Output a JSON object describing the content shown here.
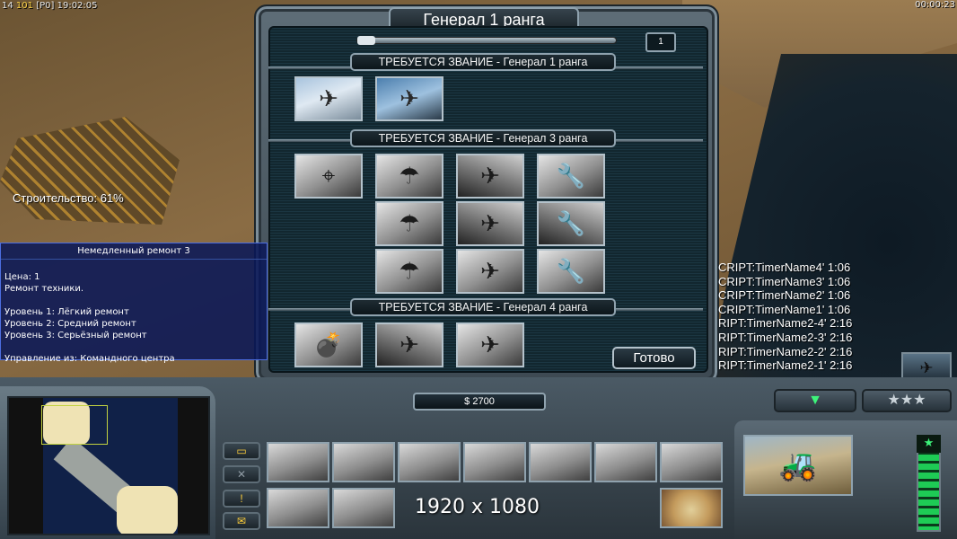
{
  "hud": {
    "top_left_prefix": "14",
    "top_left_gold": "101",
    "top_left_slot": "[P0]",
    "top_left_clock": "19:02:05",
    "top_right_clock": "00:00:23"
  },
  "world": {
    "construction_label": "Строительство: 61%"
  },
  "dialog": {
    "title": "Генерал 1 ранга",
    "points": "1",
    "done_label": "Готово",
    "sections": [
      {
        "header": "ТРЕБУЕТСЯ ЗВАНИЕ - Генерал 1 ранга"
      },
      {
        "header": "ТРЕБУЕТСЯ ЗВАНИЕ - Генерал 3 ранга"
      },
      {
        "header": "ТРЕБУЕТСЯ ЗВАНИЕ - Генерал 4 ранга"
      }
    ]
  },
  "tooltip": {
    "title": "Немедленный ремонт 3",
    "cost": "Цена: 1",
    "description": "Ремонт техники.",
    "level1": "Уровень 1: Лёгкий ремонт",
    "level2": "Уровень 2: Средний ремонт",
    "level3": "Уровень 3: Серьёзный ремонт",
    "control": "Управление из: Командного центра"
  },
  "timers": [
    "CRIPT:TimerName4' 1:06",
    "CRIPT:TimerName3' 1:06",
    "CRIPT:TimerName2' 1:06",
    "CRIPT:TimerName1' 1:06",
    "RIPT:TimerName2-4' 2:16",
    "RIPT:TimerName2-3' 2:16",
    "RIPT:TimerName2-2' 2:16",
    "RIPT:TimerName2-1' 2:16"
  ],
  "bottom": {
    "money": "$ 2700",
    "resolution_watermark": "1920 x 1080",
    "rank_stars": "★★★"
  },
  "colors": {
    "tooltip_bg": "#0a1858",
    "dialog_frame": "#5e6d77",
    "health_green": "#1ecb55",
    "accent_yellow": "#ffd54a"
  }
}
